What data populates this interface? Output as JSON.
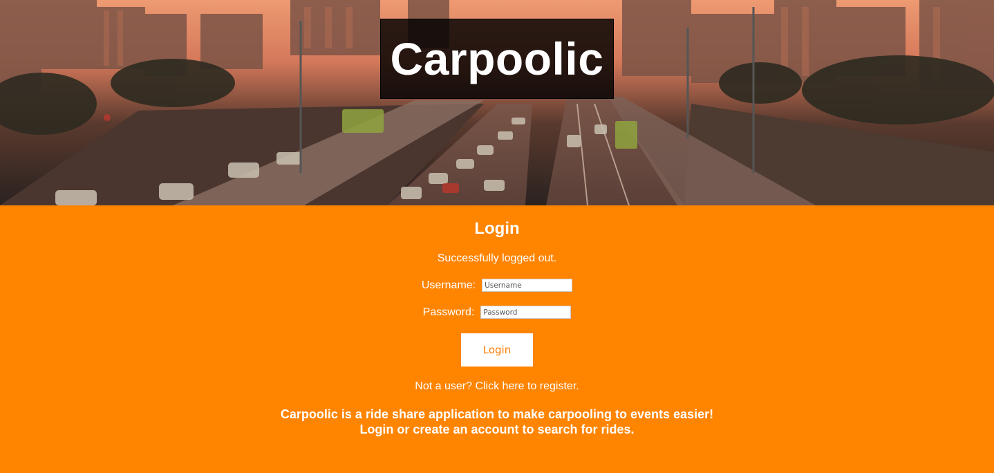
{
  "header": {
    "brand_title": "Carpoolic"
  },
  "login": {
    "heading": "Login",
    "status_message": "Successfully logged out.",
    "username_label": "Username:",
    "username_placeholder": "Username",
    "password_label": "Password:",
    "password_placeholder": "Password",
    "submit_label": "Login",
    "register_link": "Not a user? Click here to register."
  },
  "about": {
    "line1": "Carpoolic is a ride share application to make carpooling to events easier!",
    "line2": "Login or create an account to search for rides."
  },
  "colors": {
    "page_background": "#ff8400",
    "button_text": "#ff7a00",
    "brand_box": "#000000"
  },
  "hero_image": {
    "description_icon": "city-traffic-photo-icon"
  }
}
